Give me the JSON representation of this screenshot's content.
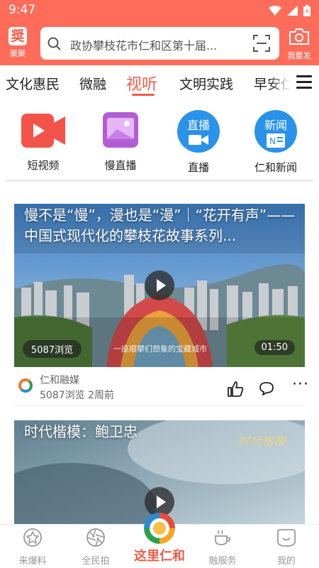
{
  "status_bar": {
    "time": "9:47"
  },
  "top_bar": {
    "logo_label": "聚聚",
    "search_placeholder": "政协攀枝花市仁和区第十届...",
    "camera_label": "我要发"
  },
  "tabs": [
    {
      "label": "文化惠民"
    },
    {
      "label": "微融"
    },
    {
      "label": "视听",
      "active": true
    },
    {
      "label": "文明实践"
    },
    {
      "label": "早安仁和"
    }
  ],
  "quick_links": [
    {
      "label": "短视频",
      "icon": "video-camera-icon"
    },
    {
      "label": "慢直播",
      "icon": "image-card-icon"
    },
    {
      "label": "直播",
      "icon_text": "直播",
      "icon": "live-icon"
    },
    {
      "label": "仁和新闻",
      "icon_text": "新闻",
      "icon": "news-icon"
    }
  ],
  "cards": [
    {
      "title": "慢不是“慢”，漫也是“漫”｜“花开有声”——中国式现代化的攀枝花故事系列...",
      "views_pill": "5087浏览",
      "duration": "01:50",
      "subtitle": "一座顺攀们想象的宝藏城市",
      "source": "仁和融媒",
      "stats": "5087浏览 2周前"
    },
    {
      "title": "时代楷模：鲍卫忠",
      "watermark": "时代楷模"
    }
  ],
  "bottom_nav": [
    {
      "label": "来爆料",
      "icon": "star-badge-icon"
    },
    {
      "label": "全民拍",
      "icon": "aperture-icon"
    },
    {
      "label": "这里仁和",
      "icon": "renhe-logo-icon",
      "active": true
    },
    {
      "label": "融服务",
      "icon": "coffee-cup-icon"
    },
    {
      "label": "我的",
      "icon": "smile-face-icon"
    }
  ],
  "colors": {
    "brand": "#ff6d5a",
    "accent": "#f05b48",
    "live_blue": "#2a92ea"
  }
}
